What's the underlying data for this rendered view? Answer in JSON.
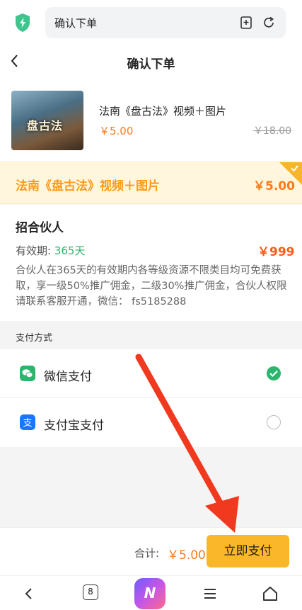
{
  "browser": {
    "url_text": "确认下单",
    "tab_count": "8",
    "app_logo_text": "N"
  },
  "header": {
    "title": "确认下单"
  },
  "product": {
    "name": "法南《盘古法》视频＋图片",
    "price": "￥5.00",
    "original_price": "￥18.00",
    "thumb_text": "盘古法"
  },
  "highlight": {
    "name": "法南《盘古法》视频＋图片",
    "price": "￥5.00"
  },
  "partner": {
    "title": "招合伙人",
    "validity_label": "有效期: ",
    "validity_value": "365天",
    "price": "￥999",
    "description": "合伙人在365天的有效期内各等级资源不限类目均可免费获取，享一级50%推广佣金，二级30%推广佣金，合伙人权限请联系客服开通，微信：  fs5185288"
  },
  "payment": {
    "section_label": "支付方式",
    "methods": [
      {
        "name": "微信支付",
        "selected": true
      },
      {
        "name": "支付宝支付",
        "selected": false
      }
    ]
  },
  "footer": {
    "total_label": "合计: ",
    "total_value": "￥5.00",
    "pay_button": "立即支付"
  },
  "colors": {
    "accent": "#fbb72a",
    "price": "#ff7a1a",
    "wechat": "#2bb56d",
    "alipay": "#1677ff",
    "arrow": "#f0391e"
  },
  "icons": [
    "shield-icon",
    "bookmark-icon",
    "refresh-icon",
    "back-icon",
    "check-icon",
    "wechat-icon",
    "alipay-icon",
    "home-icon",
    "menu-icon"
  ]
}
